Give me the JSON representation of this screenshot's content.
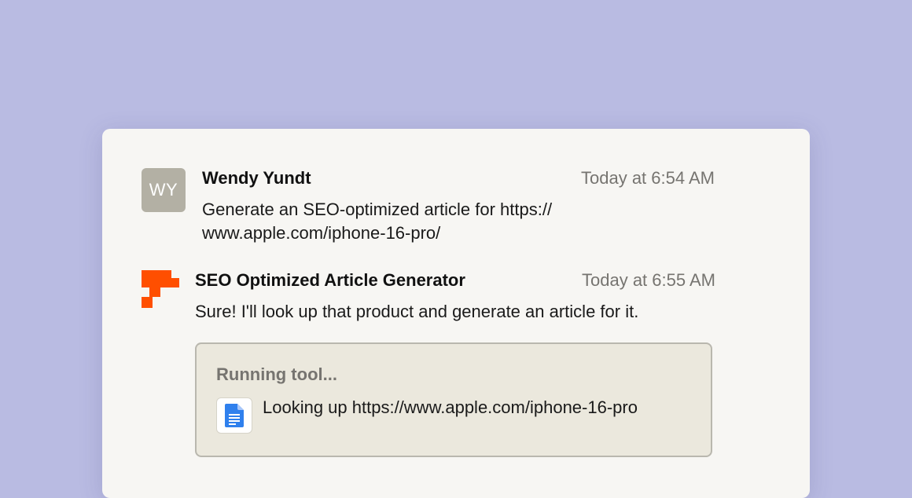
{
  "colors": {
    "background": "#b9bbe2",
    "card": "#f7f6f3",
    "avatar": "#b3b0a4",
    "brand_orange": "#ff4f00",
    "tool_box": "#ebe8dd",
    "muted_text": "#767470",
    "doc_blue": "#2f80ed"
  },
  "messages": [
    {
      "avatar_initials": "WY",
      "sender": "Wendy Yundt",
      "time": "Today at 6:54 AM",
      "text": "Generate an SEO-optimized article for https:// www.apple.com/iphone-16-pro/"
    },
    {
      "avatar_icon": "zapier-logo-icon",
      "sender": "SEO Optimized Article Generator",
      "time": "Today at 6:55 AM",
      "text": "Sure! I'll look up that product and generate an article for it.",
      "tool": {
        "title": "Running tool...",
        "icon": "google-docs-icon",
        "text": "Looking up https://www.apple.com/iphone-16-pro"
      }
    }
  ]
}
